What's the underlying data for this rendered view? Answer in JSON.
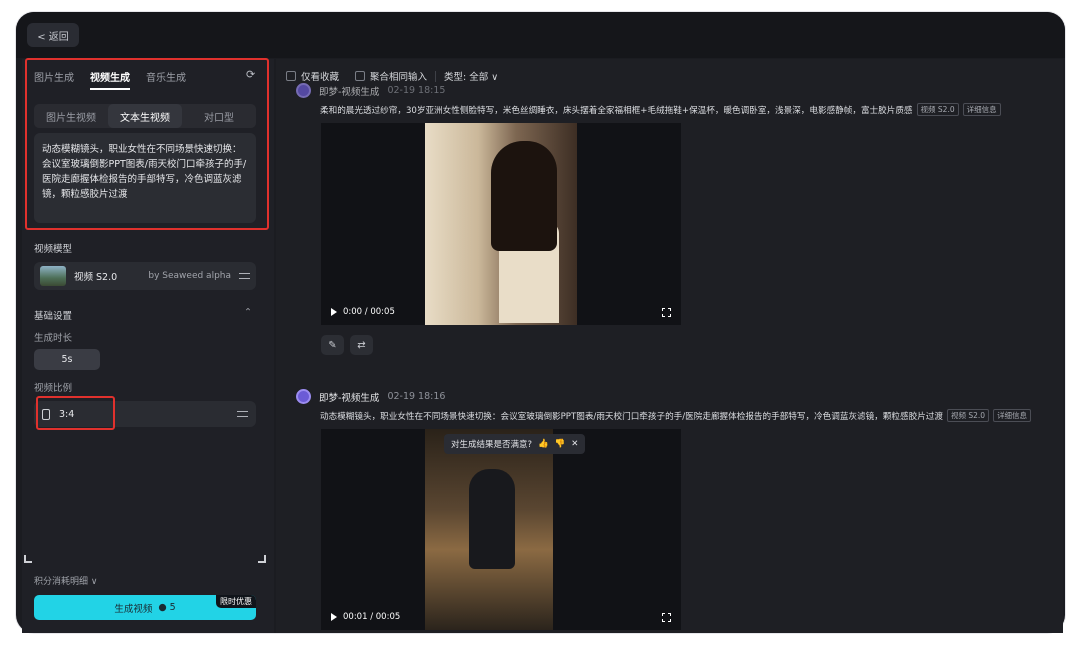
{
  "topbar": {
    "back_label": "< 返回"
  },
  "left": {
    "tabs": [
      "图片生成",
      "视频生成",
      "音乐生成"
    ],
    "subtabs": [
      "图片生视频",
      "文本生视频",
      "对口型"
    ],
    "prompt": "动态模糊镜头，职业女性在不同场景快速切换：会议室玻璃倒影PPT图表/雨天校门口牵孩子的手/医院走廊握体检报告的手部特写，冷色调蓝灰滤镜，颗粒感胶片过渡",
    "model_section": "视频模型",
    "model_name": "视频 S2.0",
    "model_by": "by Seaweed alpha",
    "basic_section": "基础设置",
    "duration_label": "生成时长",
    "duration_value": "5s",
    "ratio_label": "视频比例",
    "ratio_value": "3:4",
    "credit_label": "积分消耗明细 ∨",
    "generate_label": "生成视频",
    "generate_cost": "● 5",
    "promo": "限时优惠"
  },
  "filters": {
    "only_fav": "仅看收藏",
    "merge": "聚合相同输入",
    "type": "类型: 全部 ∨"
  },
  "items": [
    {
      "title": "即梦-视频生成",
      "date": "02-19 18:15",
      "desc": "柔和的晨光透过纱帘，30岁亚洲女性侧脸特写，米色丝绸睡衣，床头摆着全家福相框+毛绒拖鞋+保温杯，暖色调卧室，浅景深，电影感静帧，富士胶片质感",
      "tag_model": "视频 S2.0",
      "tag_detail": "详细信息",
      "time": "0:00 / 00:05"
    },
    {
      "title": "即梦-视频生成",
      "date": "02-19 18:16",
      "desc": "动态模糊镜头，职业女性在不同场景快速切换：会议室玻璃倒影PPT图表/雨天校门口牵孩子的手/医院走廊握体检报告的手部特写，冷色调蓝灰滤镜，颗粒感胶片过渡",
      "tag_model": "视频 S2.0",
      "tag_detail": "详细信息",
      "time": "00:01 / 00:05",
      "feedback": "对生成结果是否满意?"
    }
  ],
  "colors": {
    "accent": "#22d3e6",
    "highlight": "#e0312d",
    "avatar": "#6b5bd6"
  }
}
